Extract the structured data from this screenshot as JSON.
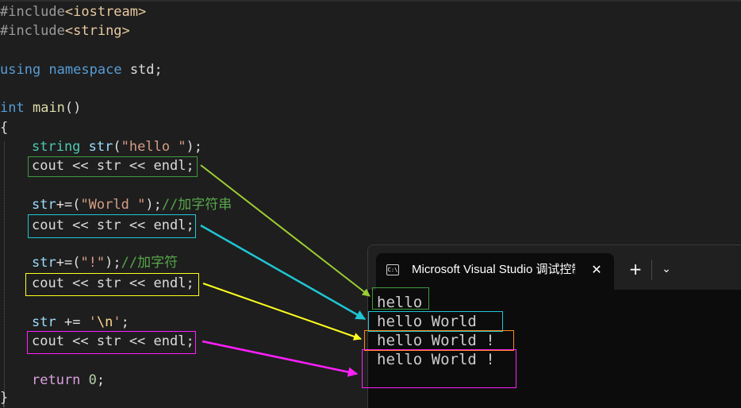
{
  "editor": {
    "lines": {
      "l1": {
        "pp": "#include",
        "hdr": "<iostream>"
      },
      "l2": {
        "pp": "#include",
        "hdr": "<string>"
      },
      "l4": {
        "kw1": "using",
        "kw2": "namespace",
        "name": "std",
        "semi": ";"
      },
      "l6": {
        "type": "int",
        "fn": "main",
        "parens": "()"
      },
      "l7": {
        "brace": "{"
      },
      "l8": {
        "type": "string",
        "var": "str",
        "open": "(",
        "str": "\"hello \"",
        "close": ");"
      },
      "l9": {
        "code": "cout << str << endl;"
      },
      "l11": {
        "var": "str",
        "op": "+=(",
        "str": "\"World \"",
        "close": ");",
        "comment": "//加字符串"
      },
      "l12": {
        "code": "cout << str << endl;"
      },
      "l14": {
        "var": "str",
        "op": "+=(",
        "str": "\"!\"",
        "close": ");",
        "comment": "//加字符"
      },
      "l15": {
        "code": "cout << str << endl;"
      },
      "l17": {
        "var": "str",
        "op": " += ",
        "q1": "'",
        "esc": "\\n",
        "q2": "'",
        "semi": ";"
      },
      "l18": {
        "code": "cout << str << endl;"
      },
      "l20": {
        "kw": "return",
        "num": "0",
        "semi": ";"
      },
      "l21": {
        "brace": "}"
      }
    }
  },
  "colors": {
    "green": "#3f9a3f",
    "cyan": "#1fc6d4",
    "yellow": "#ffff1f",
    "magenta": "#ff1fff",
    "arrow_green": "#9acd32",
    "orange": "#ff8c1a"
  },
  "terminal": {
    "tab_title": "Microsoft Visual Studio 调试控制台",
    "tab_icon": "console-app-icon",
    "tab_icon_text": "C:\\",
    "close_glyph": "✕",
    "new_tab_glyph": "+",
    "dropdown_glyph": "⌄",
    "output": [
      "hello",
      "hello World",
      "hello World !",
      "hello World !"
    ]
  }
}
